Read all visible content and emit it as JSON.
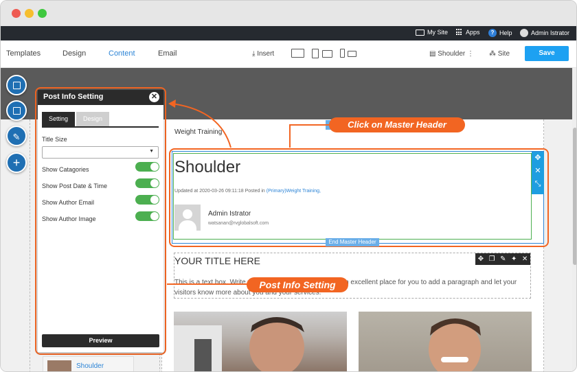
{
  "colors": {
    "accent": "#f26522",
    "primary": "#1da1f2",
    "toggle_on": "#4caf50",
    "dark": "#2b2b2b"
  },
  "window": {
    "traffic_lights": [
      "#ee5a52",
      "#f6be2e",
      "#3fc83f"
    ]
  },
  "topbar": {
    "my_site": "My Site",
    "apps": "Apps",
    "help": "Help",
    "user": "Admin Istrator"
  },
  "toolbar": {
    "tabs": [
      "Templates",
      "Design",
      "Content",
      "Email"
    ],
    "insert": "Insert",
    "page_name": "Shoulder",
    "site": "Site",
    "save": "Save"
  },
  "panel": {
    "title": "Post Info Setting",
    "tabs": [
      "Setting",
      "Design"
    ],
    "title_size_label": "Title Size",
    "title_size_value": "",
    "options": [
      {
        "label": "Show Catagories",
        "on": true
      },
      {
        "label": "Show Post Date & Time",
        "on": true
      },
      {
        "label": "Show Author Email",
        "on": true
      },
      {
        "label": "Show Author Image",
        "on": true
      }
    ],
    "preview": "Preview"
  },
  "content": {
    "breadcrumb": "Weight Training",
    "post_title": "Shoulder",
    "meta_prefix": "Updated at 2020-03-26 09:11:18 Posted in",
    "meta_links": "(Primary)Weight Training,",
    "author_name": "Admin Istrator",
    "author_email": "watsanan@rvglobalsoft.com",
    "end_master_header": "End Master Header",
    "textbox_title": "YOUR TITLE HERE",
    "textbox_body": "This is a text box. Write your own content here. This is an excellent place for you to add a paragraph and let your visitors know more about you and your services."
  },
  "callouts": {
    "master_header": "Click on Master Header",
    "post_info": "Post  Info Setting"
  },
  "sidebar_thumb": {
    "label": "Shoulder"
  }
}
